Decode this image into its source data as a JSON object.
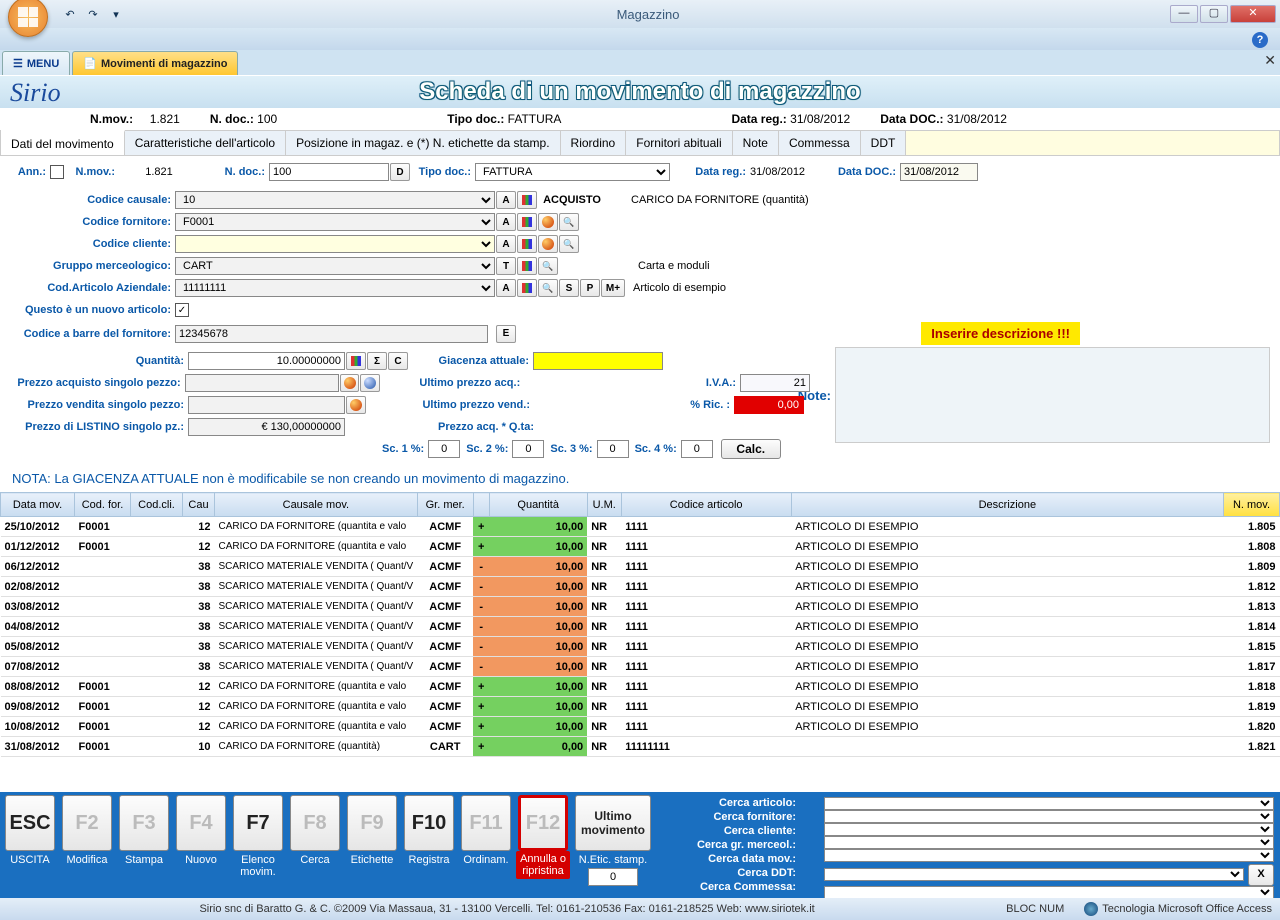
{
  "window": {
    "title": "Magazzino"
  },
  "tabs": {
    "menu": "MENU",
    "active": "Movimenti di magazzino"
  },
  "page_title": "Scheda di un movimento di magazzino",
  "logo": "Sirio",
  "summary": {
    "nmov_label": "N.mov.:",
    "nmov": "1.821",
    "ndoc_label": "N. doc.:",
    "ndoc": "100",
    "tipodoc_label": "Tipo doc.:",
    "tipodoc": "FATTURA",
    "datareg_label": "Data reg.:",
    "datareg": "31/08/2012",
    "datadoc_label": "Data DOC.:",
    "datadoc": "31/08/2012"
  },
  "subtabs": [
    "Dati del movimento",
    "Caratteristiche dell'articolo",
    "Posizione in magaz. e (*) N. etichette da stamp.",
    "Riordino",
    "Fornitori abituali",
    "Note",
    "Commessa",
    "DDT"
  ],
  "form": {
    "ann": "Ann.:",
    "nmov_label": "N.mov.:",
    "nmov": "1.821",
    "ndoc_label": "N. doc.:",
    "ndoc": "100",
    "d_btn": "D",
    "tipodoc_label": "Tipo doc.:",
    "tipodoc": "FATTURA",
    "datareg_label": "Data reg.:",
    "datareg": "31/08/2012",
    "datadoc_label": "Data DOC.:",
    "datadoc": "31/08/2012",
    "causale_label": "Codice causale:",
    "causale": "10",
    "causale_desc": "ACQUISTO",
    "causale_desc2": "CARICO DA FORNITORE (quantità)",
    "fornitore_label": "Codice fornitore:",
    "fornitore": "F0001",
    "cliente_label": "Codice cliente:",
    "gruppo_label": "Gruppo merceologico:",
    "gruppo": "CART",
    "gruppo_desc": "Carta e moduli",
    "articolo_label": "Cod.Articolo Aziendale:",
    "articolo": "11111111",
    "articolo_desc": "Articolo di esempio",
    "nuovo_label": "Questo è un nuovo articolo:",
    "barcode_label": "Codice a barre del fornitore:",
    "barcode": "12345678",
    "e_btn": "E",
    "warn": "Inserire descrizione !!!",
    "note_label": "Note:",
    "qta_label": "Quantità:",
    "qta": "10.00000000",
    "giac_label": "Giacenza attuale:",
    "pacq_label": "Prezzo acquisto singolo pezzo:",
    "uacq_label": "Ultimo prezzo acq.:",
    "pvend_label": "Prezzo vendita singolo pezzo:",
    "uvend_label": "Ultimo prezzo vend.:",
    "plist_label": "Prezzo di LISTINO singolo pz.:",
    "plist": "€ 130,00000000",
    "pqta_label": "Prezzo acq. * Q.ta:",
    "iva_label": "I.V.A.:",
    "iva": "21",
    "ric_label": "% Ric. :",
    "ric": "0,00",
    "sc1": "Sc. 1 %:",
    "sc2": "Sc. 2 %:",
    "sc3": "Sc. 3 %:",
    "sc4": "Sc. 4 %:",
    "scv": "0",
    "calc": "Calc.",
    "A": "A",
    "T": "T",
    "S": "S",
    "P": "P",
    "Mp": "M+",
    "Sigma": "Σ",
    "C": "C"
  },
  "footnote": "NOTA: La GIACENZA ATTUALE non è modificabile se non creando un movimento di magazzino.",
  "grid": {
    "headers": [
      "Data mov.",
      "Cod. for.",
      "Cod.cli.",
      "Cau",
      "Causale mov.",
      "Gr. mer.",
      "",
      "Quantità",
      "U.M.",
      "Codice articolo",
      "Descrizione",
      "N. mov."
    ],
    "rows": [
      {
        "data": "25/10/2012",
        "for": "F0001",
        "cli": "",
        "cau": "12",
        "caud": "CARICO DA FORNITORE (quantita e valo",
        "gr": "ACMF",
        "s": "+",
        "q": "10,00",
        "um": "NR",
        "art": "1111",
        "desc": "ARTICOLO DI ESEMPIO",
        "n": "1.805"
      },
      {
        "data": "01/12/2012",
        "for": "F0001",
        "cli": "",
        "cau": "12",
        "caud": "CARICO DA FORNITORE (quantita e valo",
        "gr": "ACMF",
        "s": "+",
        "q": "10,00",
        "um": "NR",
        "art": "1111",
        "desc": "ARTICOLO DI ESEMPIO",
        "n": "1.808"
      },
      {
        "data": "06/12/2012",
        "for": "",
        "cli": "",
        "cau": "38",
        "caud": "SCARICO MATERIALE VENDITA ( Quant/V",
        "gr": "ACMF",
        "s": "-",
        "q": "10,00",
        "um": "NR",
        "art": "1111",
        "desc": "ARTICOLO DI ESEMPIO",
        "n": "1.809"
      },
      {
        "data": "02/08/2012",
        "for": "",
        "cli": "",
        "cau": "38",
        "caud": "SCARICO MATERIALE VENDITA ( Quant/V",
        "gr": "ACMF",
        "s": "-",
        "q": "10,00",
        "um": "NR",
        "art": "1111",
        "desc": "ARTICOLO DI ESEMPIO",
        "n": "1.812"
      },
      {
        "data": "03/08/2012",
        "for": "",
        "cli": "",
        "cau": "38",
        "caud": "SCARICO MATERIALE VENDITA ( Quant/V",
        "gr": "ACMF",
        "s": "-",
        "q": "10,00",
        "um": "NR",
        "art": "1111",
        "desc": "ARTICOLO DI ESEMPIO",
        "n": "1.813"
      },
      {
        "data": "04/08/2012",
        "for": "",
        "cli": "",
        "cau": "38",
        "caud": "SCARICO MATERIALE VENDITA ( Quant/V",
        "gr": "ACMF",
        "s": "-",
        "q": "10,00",
        "um": "NR",
        "art": "1111",
        "desc": "ARTICOLO DI ESEMPIO",
        "n": "1.814"
      },
      {
        "data": "05/08/2012",
        "for": "",
        "cli": "",
        "cau": "38",
        "caud": "SCARICO MATERIALE VENDITA ( Quant/V",
        "gr": "ACMF",
        "s": "-",
        "q": "10,00",
        "um": "NR",
        "art": "1111",
        "desc": "ARTICOLO DI ESEMPIO",
        "n": "1.815"
      },
      {
        "data": "07/08/2012",
        "for": "",
        "cli": "",
        "cau": "38",
        "caud": "SCARICO MATERIALE VENDITA ( Quant/V",
        "gr": "ACMF",
        "s": "-",
        "q": "10,00",
        "um": "NR",
        "art": "1111",
        "desc": "ARTICOLO DI ESEMPIO",
        "n": "1.817"
      },
      {
        "data": "08/08/2012",
        "for": "F0001",
        "cli": "",
        "cau": "12",
        "caud": "CARICO DA FORNITORE (quantita e valo",
        "gr": "ACMF",
        "s": "+",
        "q": "10,00",
        "um": "NR",
        "art": "1111",
        "desc": "ARTICOLO DI ESEMPIO",
        "n": "1.818"
      },
      {
        "data": "09/08/2012",
        "for": "F0001",
        "cli": "",
        "cau": "12",
        "caud": "CARICO DA FORNITORE (quantita e valo",
        "gr": "ACMF",
        "s": "+",
        "q": "10,00",
        "um": "NR",
        "art": "1111",
        "desc": "ARTICOLO DI ESEMPIO",
        "n": "1.819"
      },
      {
        "data": "10/08/2012",
        "for": "F0001",
        "cli": "",
        "cau": "12",
        "caud": "CARICO DA FORNITORE (quantita e valo",
        "gr": "ACMF",
        "s": "+",
        "q": "10,00",
        "um": "NR",
        "art": "1111",
        "desc": "ARTICOLO DI ESEMPIO",
        "n": "1.820"
      },
      {
        "data": "31/08/2012",
        "for": "F0001",
        "cli": "",
        "cau": "10",
        "caud": "CARICO DA FORNITORE (quantità)",
        "gr": "CART",
        "s": "+",
        "q": "0,00",
        "um": "NR",
        "art": "11111111",
        "desc": "",
        "n": "1.821"
      }
    ]
  },
  "fkeys": [
    {
      "k": "ESC",
      "lbl": "USCITA",
      "on": true
    },
    {
      "k": "F2",
      "lbl": "Modifica"
    },
    {
      "k": "F3",
      "lbl": "Stampa"
    },
    {
      "k": "F4",
      "lbl": "Nuovo"
    },
    {
      "k": "F7",
      "lbl": "Elenco movim.",
      "on": true
    },
    {
      "k": "F8",
      "lbl": "Cerca"
    },
    {
      "k": "F9",
      "lbl": "Etichette"
    },
    {
      "k": "F10",
      "lbl": "Registra",
      "on": true
    },
    {
      "k": "F11",
      "lbl": "Ordinam."
    },
    {
      "k": "F12",
      "lbl": "Annulla o ripristina",
      "f12": true
    }
  ],
  "ultimo": {
    "top": "Ultimo movimento",
    "lbl": "N.Etic. stamp.",
    "val": "0"
  },
  "search": [
    "Cerca articolo:",
    "Cerca fornitore:",
    "Cerca cliente:",
    "Cerca gr. merceol.:",
    "Cerca data mov.:",
    "Cerca DDT:",
    "Cerca Commessa:"
  ],
  "x_btn": "X",
  "status": {
    "center": "Sirio snc di Baratto G. & C. ©2009 Via Massaua, 31 - 13100 Vercelli. Tel: 0161-210536 Fax: 0161-218525 Web: www.siriotek.it",
    "bloc": "BLOC NUM",
    "tech": "Tecnologia Microsoft Office Access"
  }
}
